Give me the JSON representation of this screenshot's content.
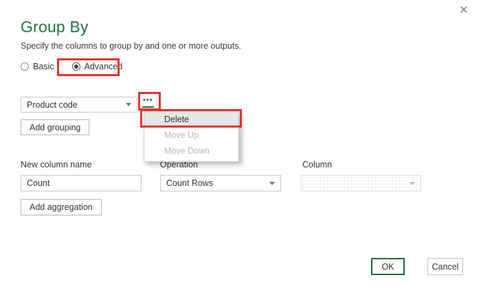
{
  "dialog": {
    "title": "Group By",
    "subtitle": "Specify the columns to group by and one or more outputs.",
    "close_glyph": "✕"
  },
  "mode": {
    "basic_label": "Basic",
    "advanced_label": "Advanced",
    "selected": "Advanced"
  },
  "grouping": {
    "column_value": "Product code",
    "ellipsis_glyph": "•••",
    "add_button_label": "Add grouping"
  },
  "context_menu": {
    "items": [
      {
        "label": "Delete",
        "enabled": true,
        "highlighted": true
      },
      {
        "label": "Move Up",
        "enabled": false,
        "highlighted": false
      },
      {
        "label": "Move Down",
        "enabled": false,
        "highlighted": false
      }
    ]
  },
  "aggregation": {
    "new_column_label": "New column name",
    "new_column_value": "Count",
    "operation_label": "Operation",
    "operation_value": "Count Rows",
    "column_label": "Column",
    "column_value": ""
  },
  "aggregation_button_label": "Add aggregation",
  "footer": {
    "ok_label": "OK",
    "cancel_label": "Cancel"
  },
  "colors": {
    "title_green": "#217346",
    "annotation_red": "#e0352b",
    "ok_border_green": "#1d6a40",
    "disabled_text": "#b8b8b8"
  }
}
